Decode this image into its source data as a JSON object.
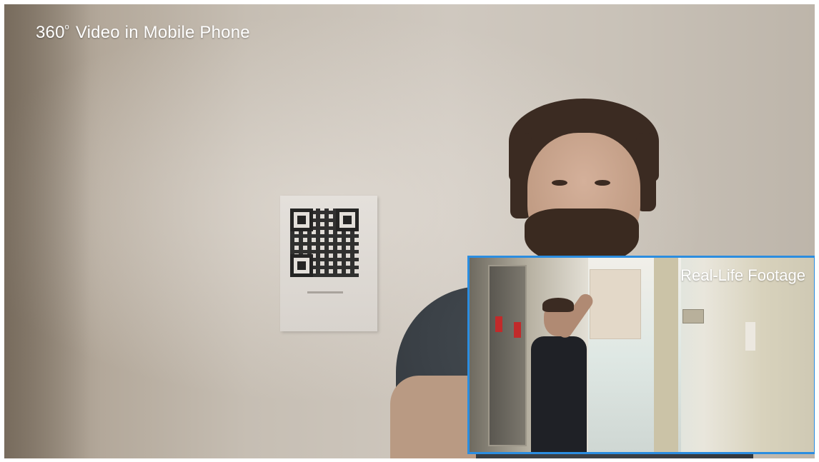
{
  "overlay_title": {
    "main": "360",
    "degree": "o",
    "rest": "Video in Mobile Phone"
  },
  "inset": {
    "label": "Real-Life Footage",
    "border_color": "#2b8de0"
  }
}
